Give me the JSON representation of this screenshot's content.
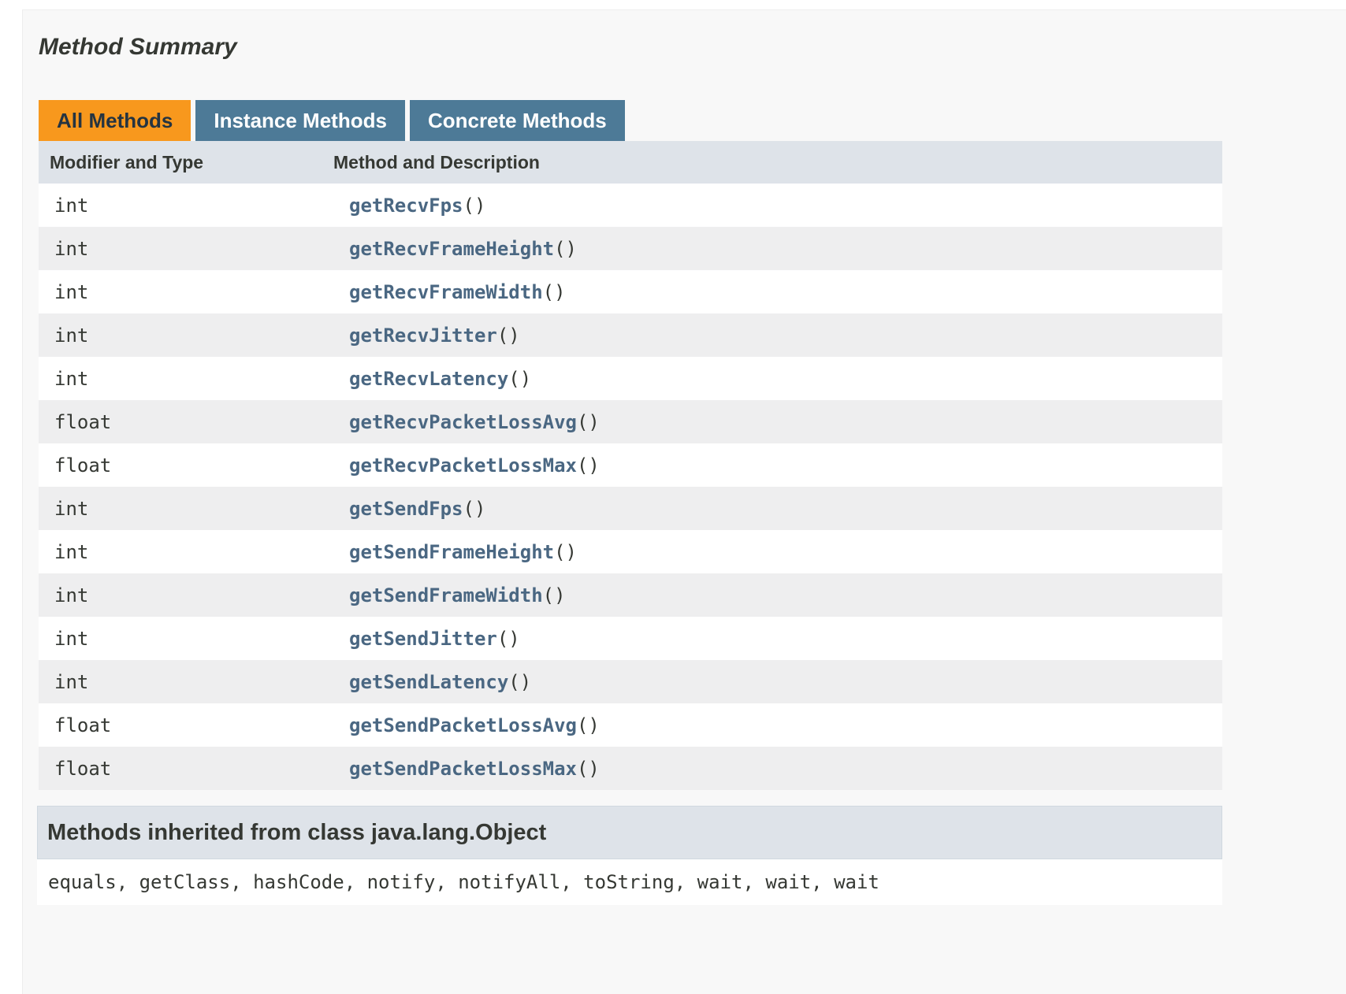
{
  "summary": {
    "title": "Method Summary"
  },
  "tabs": [
    {
      "label": "All Methods",
      "active": true
    },
    {
      "label": "Instance Methods",
      "active": false
    },
    {
      "label": "Concrete Methods",
      "active": false
    }
  ],
  "table": {
    "headers": {
      "modifier": "Modifier and Type",
      "method": "Method and Description"
    },
    "rows": [
      {
        "type": "int",
        "method": "getRecvFps",
        "params": "()"
      },
      {
        "type": "int",
        "method": "getRecvFrameHeight",
        "params": "()"
      },
      {
        "type": "int",
        "method": "getRecvFrameWidth",
        "params": "()"
      },
      {
        "type": "int",
        "method": "getRecvJitter",
        "params": "()"
      },
      {
        "type": "int",
        "method": "getRecvLatency",
        "params": "()"
      },
      {
        "type": "float",
        "method": "getRecvPacketLossAvg",
        "params": "()"
      },
      {
        "type": "float",
        "method": "getRecvPacketLossMax",
        "params": "()"
      },
      {
        "type": "int",
        "method": "getSendFps",
        "params": "()"
      },
      {
        "type": "int",
        "method": "getSendFrameHeight",
        "params": "()"
      },
      {
        "type": "int",
        "method": "getSendFrameWidth",
        "params": "()"
      },
      {
        "type": "int",
        "method": "getSendJitter",
        "params": "()"
      },
      {
        "type": "int",
        "method": "getSendLatency",
        "params": "()"
      },
      {
        "type": "float",
        "method": "getSendPacketLossAvg",
        "params": "()"
      },
      {
        "type": "float",
        "method": "getSendPacketLossMax",
        "params": "()"
      }
    ]
  },
  "inherited": {
    "title": "Methods inherited from class java.lang.Object",
    "methods": [
      "equals",
      "getClass",
      "hashCode",
      "notify",
      "notifyAll",
      "toString",
      "wait",
      "wait",
      "wait"
    ],
    "separator": ", "
  },
  "colors": {
    "active_tab": "#f8981d",
    "inactive_tab": "#4d7a97",
    "header_bg": "#dee3e9",
    "link": "#4a6782",
    "row_alt": "#eeeeef"
  }
}
